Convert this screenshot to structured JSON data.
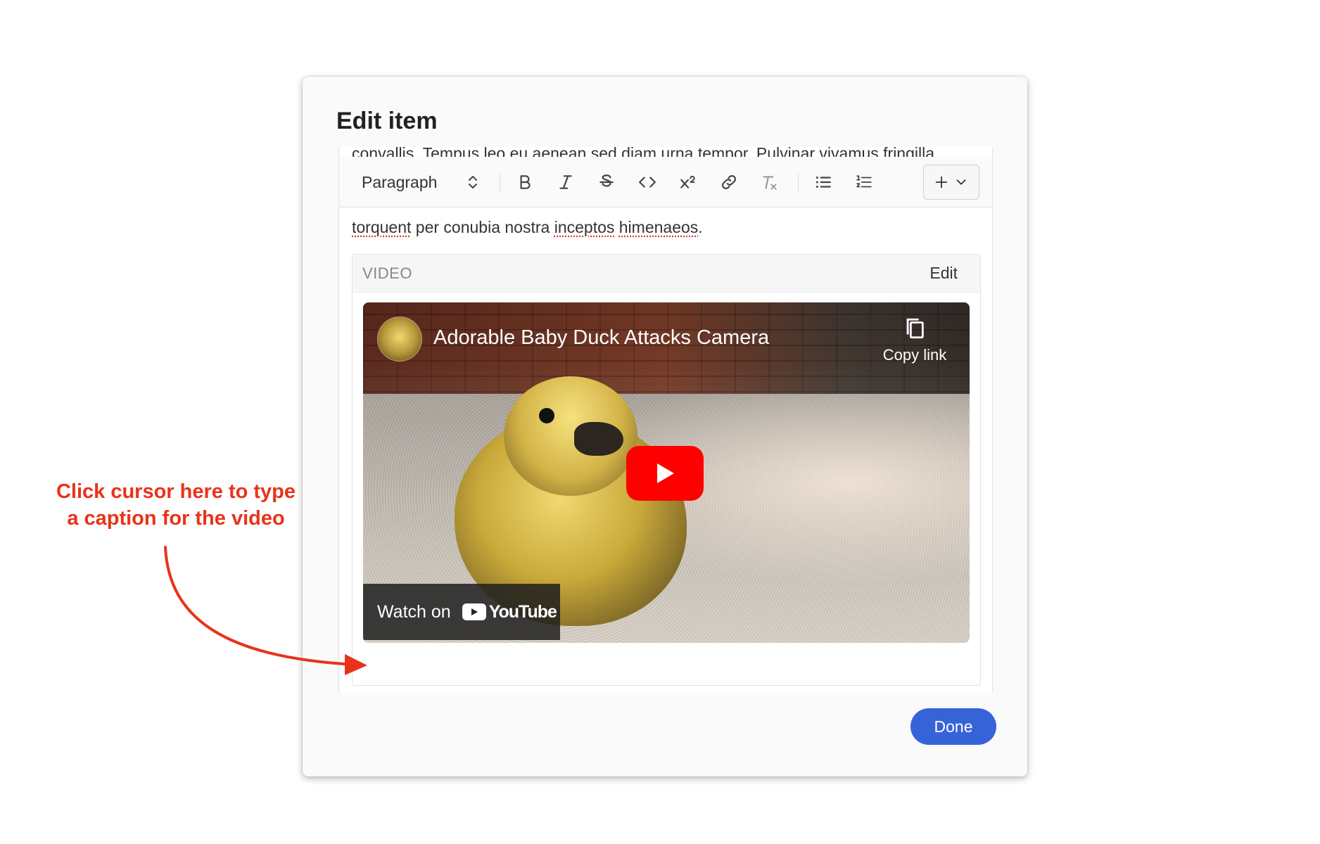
{
  "modal": {
    "title": "Edit item",
    "done_label": "Done"
  },
  "editor": {
    "scrolled_text": "convallis. Tempus leo eu aenean sed diam urna tempor. Pulvinar vivamus fringilla",
    "paragraph_parts": [
      "torquent",
      " per conubia nostra ",
      "inceptos",
      " ",
      "himenaeos",
      "."
    ],
    "toolbar": {
      "block_type": "Paragraph",
      "buttons": [
        "bold-icon",
        "italic-icon",
        "strikethrough-icon",
        "code-icon",
        "superscript-icon",
        "link-icon",
        "clear-format-icon",
        "bullet-list-icon",
        "numbered-list-icon",
        "insert-icon"
      ]
    }
  },
  "video_block": {
    "label": "VIDEO",
    "edit_label": "Edit",
    "video_title": "Adorable Baby Duck Attacks Camera",
    "copy_link_label": "Copy link",
    "watch_on_label": "Watch on",
    "youtube_wordmark": "YouTube"
  },
  "annotation": {
    "line1": "Click cursor here to type",
    "line2": "a caption for the video"
  },
  "colors": {
    "primary": "#3763d9",
    "youtube_red": "#ff0000",
    "annotation_red": "#e8331a"
  }
}
